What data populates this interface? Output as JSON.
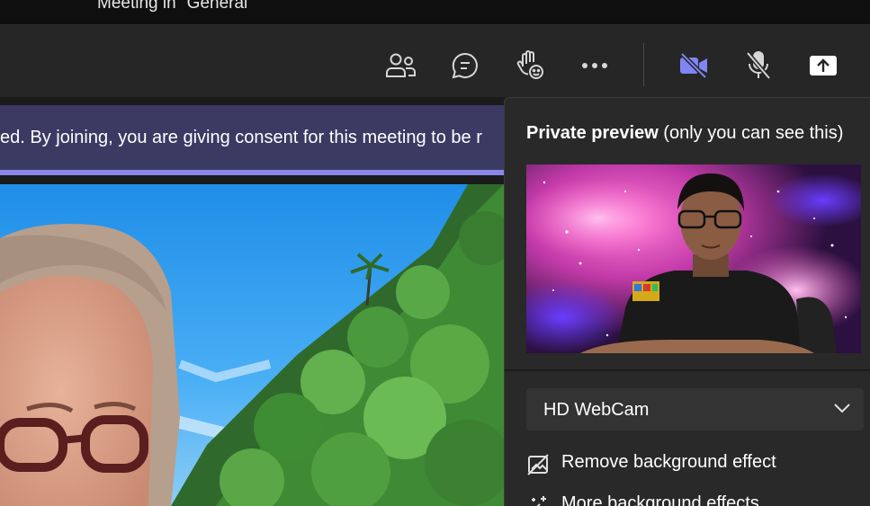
{
  "window": {
    "title": "Meeting in \"General\""
  },
  "toolbar": {
    "buttons": [
      {
        "id": "participants",
        "icon": "people-icon"
      },
      {
        "id": "chat",
        "icon": "chat-icon"
      },
      {
        "id": "react",
        "icon": "raise-hand-icon"
      },
      {
        "id": "more",
        "icon": "more-icon"
      },
      {
        "id": "camera",
        "icon": "camera-off-icon"
      },
      {
        "id": "mic",
        "icon": "mic-off-icon"
      },
      {
        "id": "share",
        "icon": "share-icon"
      }
    ],
    "colors": {
      "camera_active": "#7f85f5",
      "icon": "#d6d6d6"
    }
  },
  "banner": {
    "text": "ed. By joining, you are giving consent for this meeting to be r"
  },
  "panel": {
    "heading_bold": "Private preview",
    "heading_rest": " (only you can see this)",
    "device_select": {
      "value": "HD WebCam"
    },
    "options": [
      {
        "label": "Remove background effect",
        "icon": "no-background-icon"
      },
      {
        "label": "More background effects",
        "icon": "sparkle-icon"
      }
    ]
  }
}
